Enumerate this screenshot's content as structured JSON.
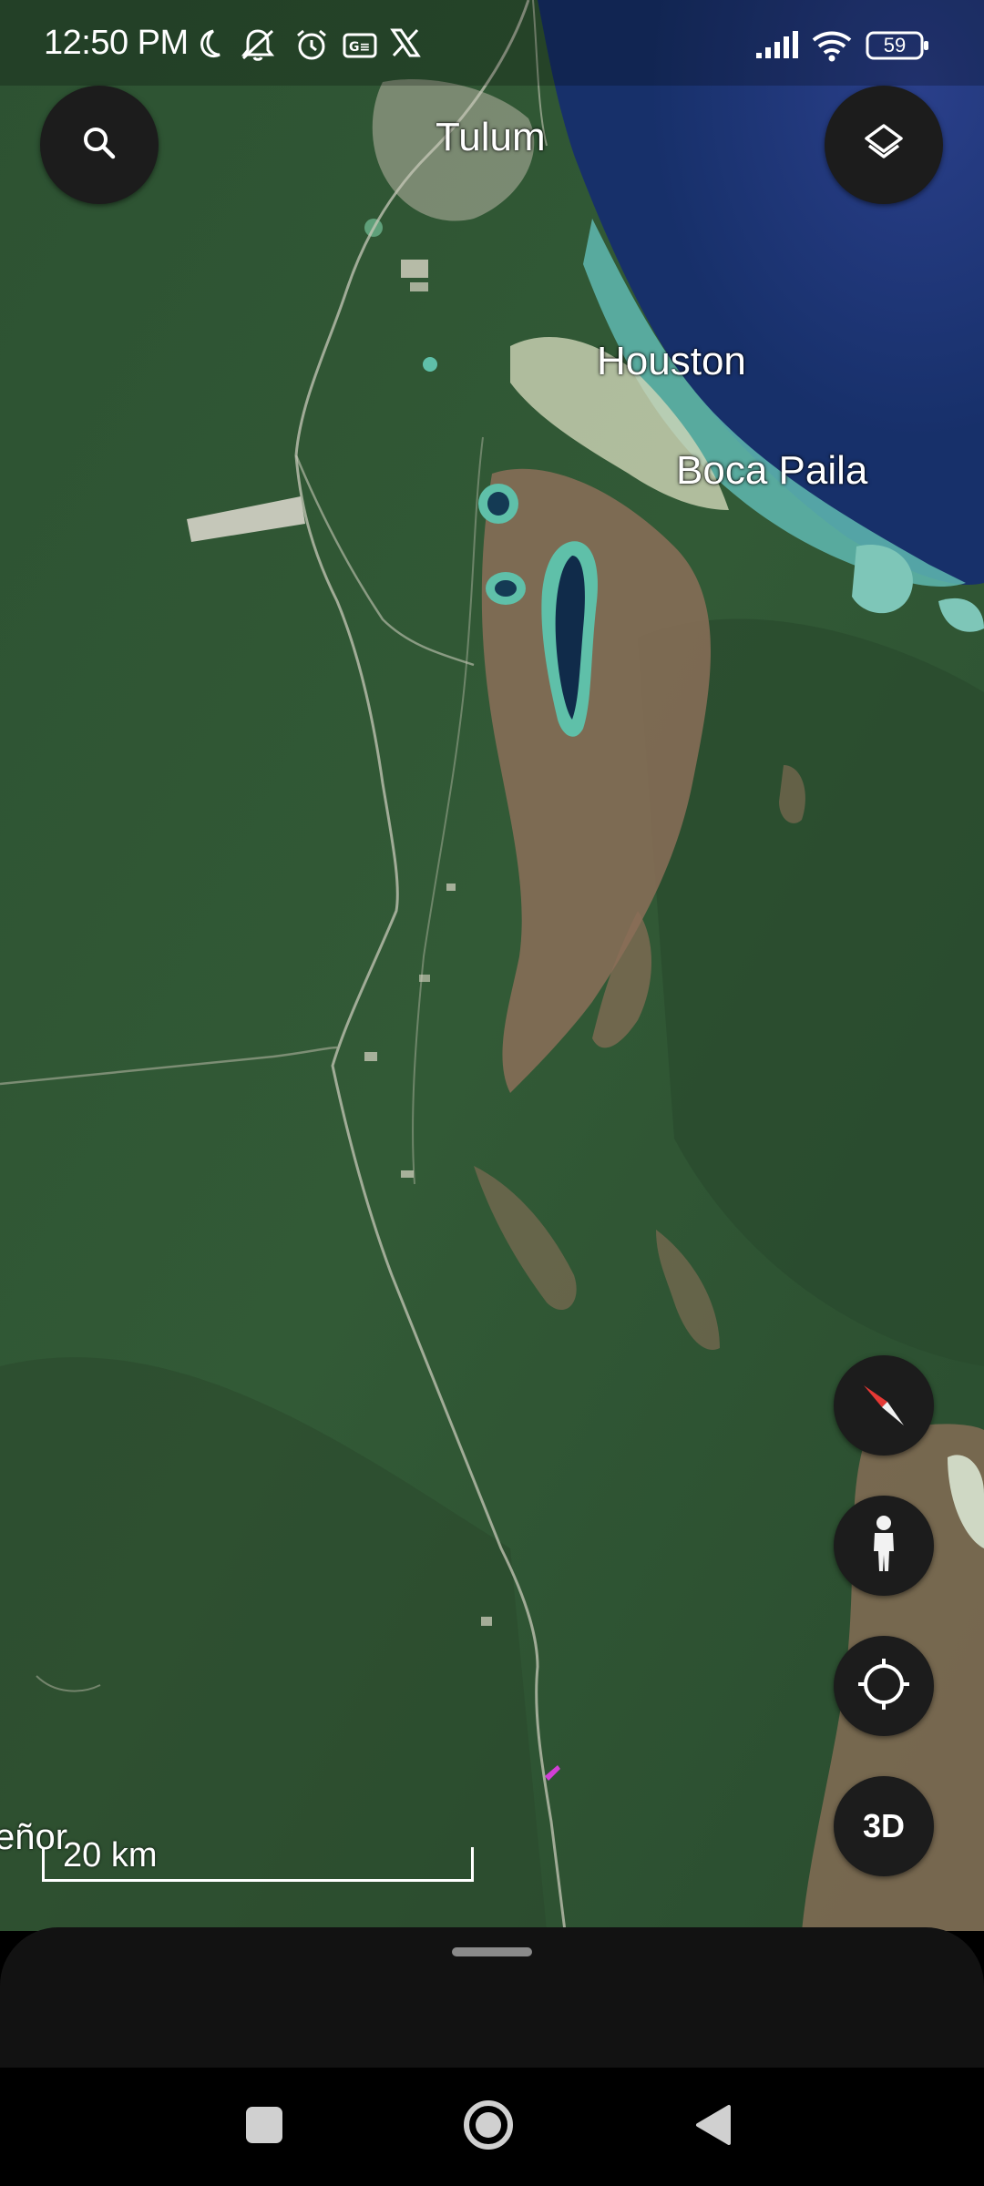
{
  "status_bar": {
    "time": "12:50 PM",
    "battery": "59",
    "icons": [
      "moon-icon",
      "muted-bell-icon",
      "alarm-icon",
      "news-app-icon",
      "x-logo-icon",
      "signal-icon",
      "wifi-icon",
      "battery-icon"
    ]
  },
  "map": {
    "labels": {
      "tulum": "Tulum",
      "houston": "Houston",
      "boca_paila": "Boca Paila",
      "cut_off": "eñor"
    },
    "scale_label": "20 km"
  },
  "controls": {
    "search_icon": "search-icon",
    "layers_icon": "layers-icon",
    "compass_icon": "compass-icon",
    "pegman_icon": "pegman-icon",
    "my_location_icon": "my-location-icon",
    "three_d_label": "3D"
  },
  "nav_bar": {
    "icons": [
      "recents-square-icon",
      "home-circle-icon",
      "back-triangle-icon"
    ]
  },
  "colors": {
    "forest": "#2f5233",
    "ocean": "#1f3a78",
    "lagoon": "#4fb7a6",
    "wetland": "#8a6e55",
    "control_bg": "#1c1c1c",
    "compass_red": "#e53935"
  }
}
